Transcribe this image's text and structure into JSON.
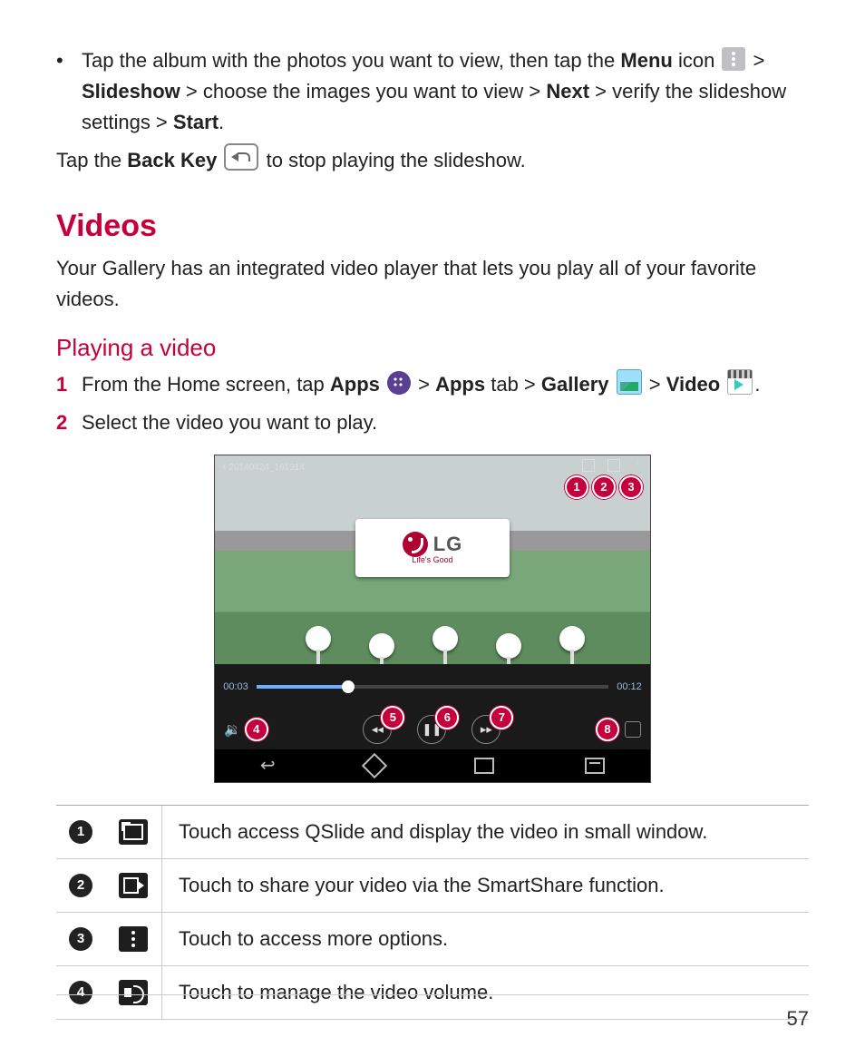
{
  "bullet1": {
    "seg1": "Tap the album with the photos you want to view, then tap the ",
    "bold1": "Menu",
    "seg2": " icon ",
    "seg3": " > ",
    "bold2": "Slideshow",
    "seg4": " > choose the images you want to view > ",
    "bold3": "Next",
    "seg5": " > verify the slideshow settings > ",
    "bold4": "Start",
    "seg6": "."
  },
  "line2": {
    "seg1": "Tap the ",
    "bold1": "Back Key",
    "seg2": " to stop playing the slideshow."
  },
  "h2_videos": "Videos",
  "videos_intro": "Your Gallery has an integrated video player that lets you play all of your favorite videos.",
  "h3_playing": "Playing a video",
  "step1": {
    "num": "1",
    "seg1": "From the Home screen, tap ",
    "bold1": "Apps",
    "seg2": " > ",
    "bold2": "Apps",
    "seg3": " tab > ",
    "bold3": "Gallery",
    "seg4": " > ",
    "bold4": "Video",
    "seg5": "."
  },
  "step2": {
    "num": "2",
    "text": "Select the video you want to play."
  },
  "screenshot": {
    "filename": "20140424_161314",
    "board_brand": "LG",
    "board_slogan": "Life's Good",
    "time_elapsed": "00:03",
    "time_total": "00:12",
    "callouts_top": [
      "1",
      "2",
      "3"
    ],
    "callout_rewind": "5",
    "callout_pause": "6",
    "callout_forward": "7",
    "callout_volume": "4",
    "callout_screenshot": "8"
  },
  "legend": [
    {
      "n": "1",
      "text": "Touch access QSlide and display the video in small window."
    },
    {
      "n": "2",
      "text": "Touch to share your video via the SmartShare function."
    },
    {
      "n": "3",
      "text": "Touch to access more options."
    },
    {
      "n": "4",
      "text": "Touch to manage the video volume."
    }
  ],
  "page_number": "57"
}
